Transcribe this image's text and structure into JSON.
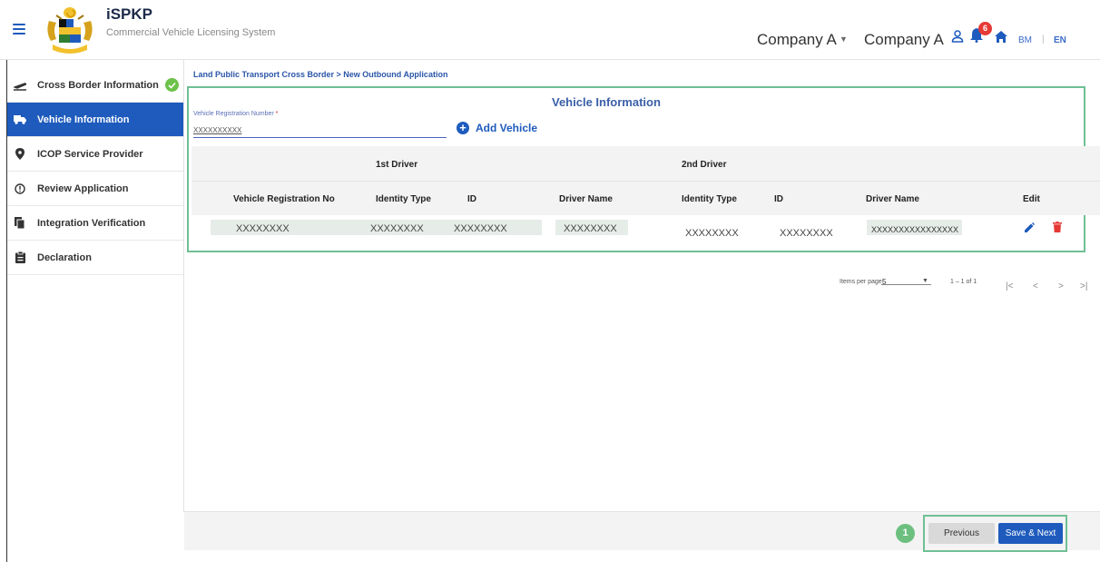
{
  "app": {
    "title": "iSPKP",
    "subtitle": "Commercial Vehicle Licensing System"
  },
  "header": {
    "company_1": "Company A",
    "company_2": "Company A",
    "notification_count": "6",
    "lang_bm": "BM",
    "lang_separator": "|",
    "lang_en": "EN"
  },
  "sidebar": {
    "items": [
      {
        "label": "Cross Border Information",
        "icon": "flight-takeoff-icon",
        "completed": true
      },
      {
        "label": "Vehicle Information",
        "icon": "truck-icon",
        "active": true
      },
      {
        "label": "ICOP Service Provider",
        "icon": "location-pin-icon"
      },
      {
        "label": "Review Application",
        "icon": "info-circle-icon"
      },
      {
        "label": "Integration Verification",
        "icon": "documents-icon"
      },
      {
        "label": "Declaration",
        "icon": "clipboard-icon"
      }
    ]
  },
  "breadcrumb": "Land Public Transport Cross Border > New Outbound Application",
  "section": {
    "title": "Vehicle Information",
    "field_label": "Vehicle Registration Number",
    "required_mark": "*",
    "field_value": "XXXXXXXXXX",
    "add_vehicle": "Add Vehicle"
  },
  "table": {
    "group_headers": {
      "driver1": "1st Driver",
      "driver2": "2nd Driver"
    },
    "columns": [
      "Vehicle Registration No",
      "Identity Type",
      "ID",
      "Driver Name",
      "Identity Type",
      "ID",
      "Driver Name",
      "Edit"
    ],
    "rows": [
      [
        "XXXXXXXX",
        "XXXXXXXX",
        "XXXXXXXX",
        "XXXXXXXX",
        "XXXXXXXX",
        "XXXXXXXX",
        "XXXXXXXXXXXXXXXX"
      ]
    ]
  },
  "paginator": {
    "items_per_page_label": "Items per page:",
    "page_size": "5",
    "range": "1 – 1 of 1"
  },
  "footer": {
    "step_number": "1",
    "previous": "Previous",
    "save_next": "Save & Next"
  },
  "colors": {
    "primary": "#1e5bbd",
    "highlight_border": "#6fbf94",
    "check_green": "#6cc24a",
    "delete_red": "#e53935"
  }
}
